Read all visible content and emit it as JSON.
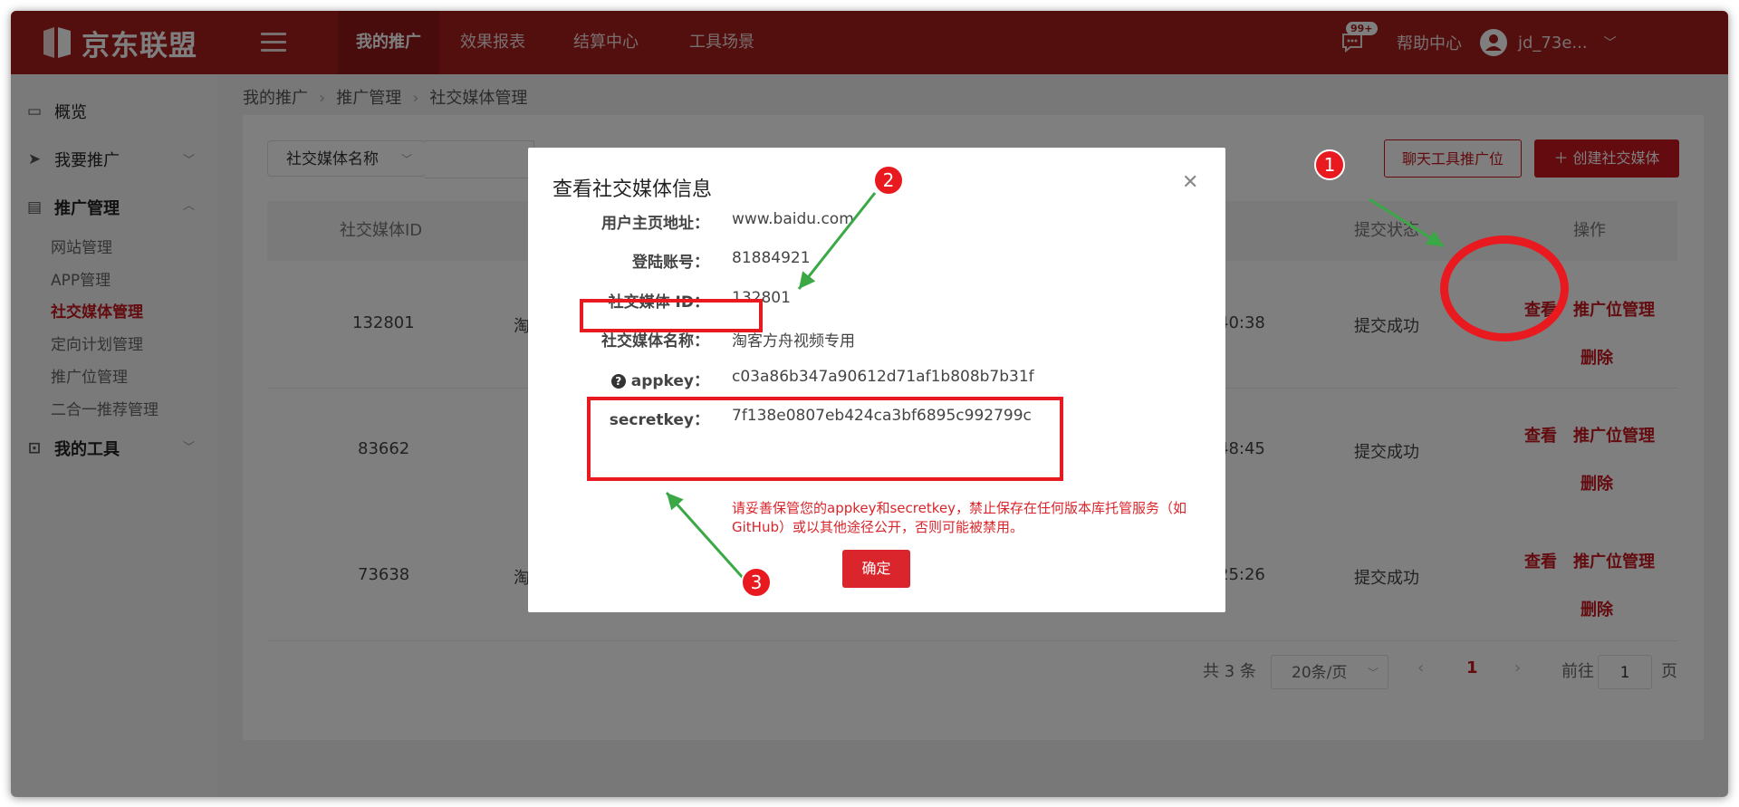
{
  "header": {
    "logo_text": "京东联盟",
    "nav_tabs": [
      {
        "label": "我的推广"
      },
      {
        "label": "效果报表"
      },
      {
        "label": "结算中心"
      },
      {
        "label": "工具场景"
      }
    ],
    "message_badge": "99+",
    "help_label": "帮助中心",
    "user_name": "jd_73e..."
  },
  "sidebar": {
    "overview": "概览",
    "promote": "我要推广",
    "manage": "推广管理",
    "sub_items": [
      {
        "label": "网站管理"
      },
      {
        "label": "APP管理"
      },
      {
        "label": "社交媒体管理"
      },
      {
        "label": "定向计划管理"
      },
      {
        "label": "推广位管理"
      },
      {
        "label": "二合一推荐管理"
      }
    ],
    "tools": "我的工具"
  },
  "breadcrumb": {
    "items": [
      "我的推广",
      "推广管理",
      "社交媒体管理"
    ]
  },
  "toolbar": {
    "filter_select": "社交媒体名称",
    "chat_tool_button": "聊天工具推广位",
    "create_button": "＋ 创建社交媒体"
  },
  "table": {
    "headers": {
      "id": "社交媒体ID",
      "status": "提交状态",
      "ops": "操作"
    },
    "rows": [
      {
        "id": "132801",
        "name_partial": "淘",
        "time_partial": "40:38",
        "status": "提交成功",
        "view": "查看",
        "pos_manage": "推广位管理",
        "delete": "删除"
      },
      {
        "id": "83662",
        "name_partial": "",
        "time_partial": "48:45",
        "status": "提交成功",
        "view": "查看",
        "pos_manage": "推广位管理",
        "delete": "删除"
      },
      {
        "id": "73638",
        "name_partial": "淘",
        "time_partial": "25:26",
        "status": "提交成功",
        "view": "查看",
        "pos_manage": "推广位管理",
        "delete": "删除"
      }
    ]
  },
  "pagination": {
    "total": "共 3 条",
    "page_size": "20条/页",
    "current_page": "1",
    "goto_label": "前往",
    "goto_value": "1",
    "page_unit": "页"
  },
  "modal": {
    "title": "查看社交媒体信息",
    "fields": {
      "homepage_label": "用户主页地址：",
      "homepage_value": "www.baidu.com",
      "account_label": "登陆账号：",
      "account_value": "81884921",
      "id_label": "社交媒体 ID：",
      "id_value": "132801",
      "name_label": "社交媒体名称：",
      "name_value": "淘客方舟视频专用",
      "appkey_label": "appkey：",
      "appkey_value": "c03a86b347a90612d71af1b808b7b31f",
      "secretkey_label": "secretkey：",
      "secretkey_value": "7f138e0807eb424ca3bf6895c992799c"
    },
    "warning": "请妥善保管您的appkey和secretkey，禁止保存在任何版本库托管服务（如GitHub）或以其他途径公开，否则可能被禁用。",
    "ok_button": "确定"
  },
  "annotations": {
    "marker_1": "1",
    "marker_2": "2",
    "marker_3": "3",
    "color": "#e8191f",
    "arrow_color": "#3aa845"
  },
  "colors": {
    "brand_red": "#a61c1c",
    "accent_red": "#c7161e"
  }
}
